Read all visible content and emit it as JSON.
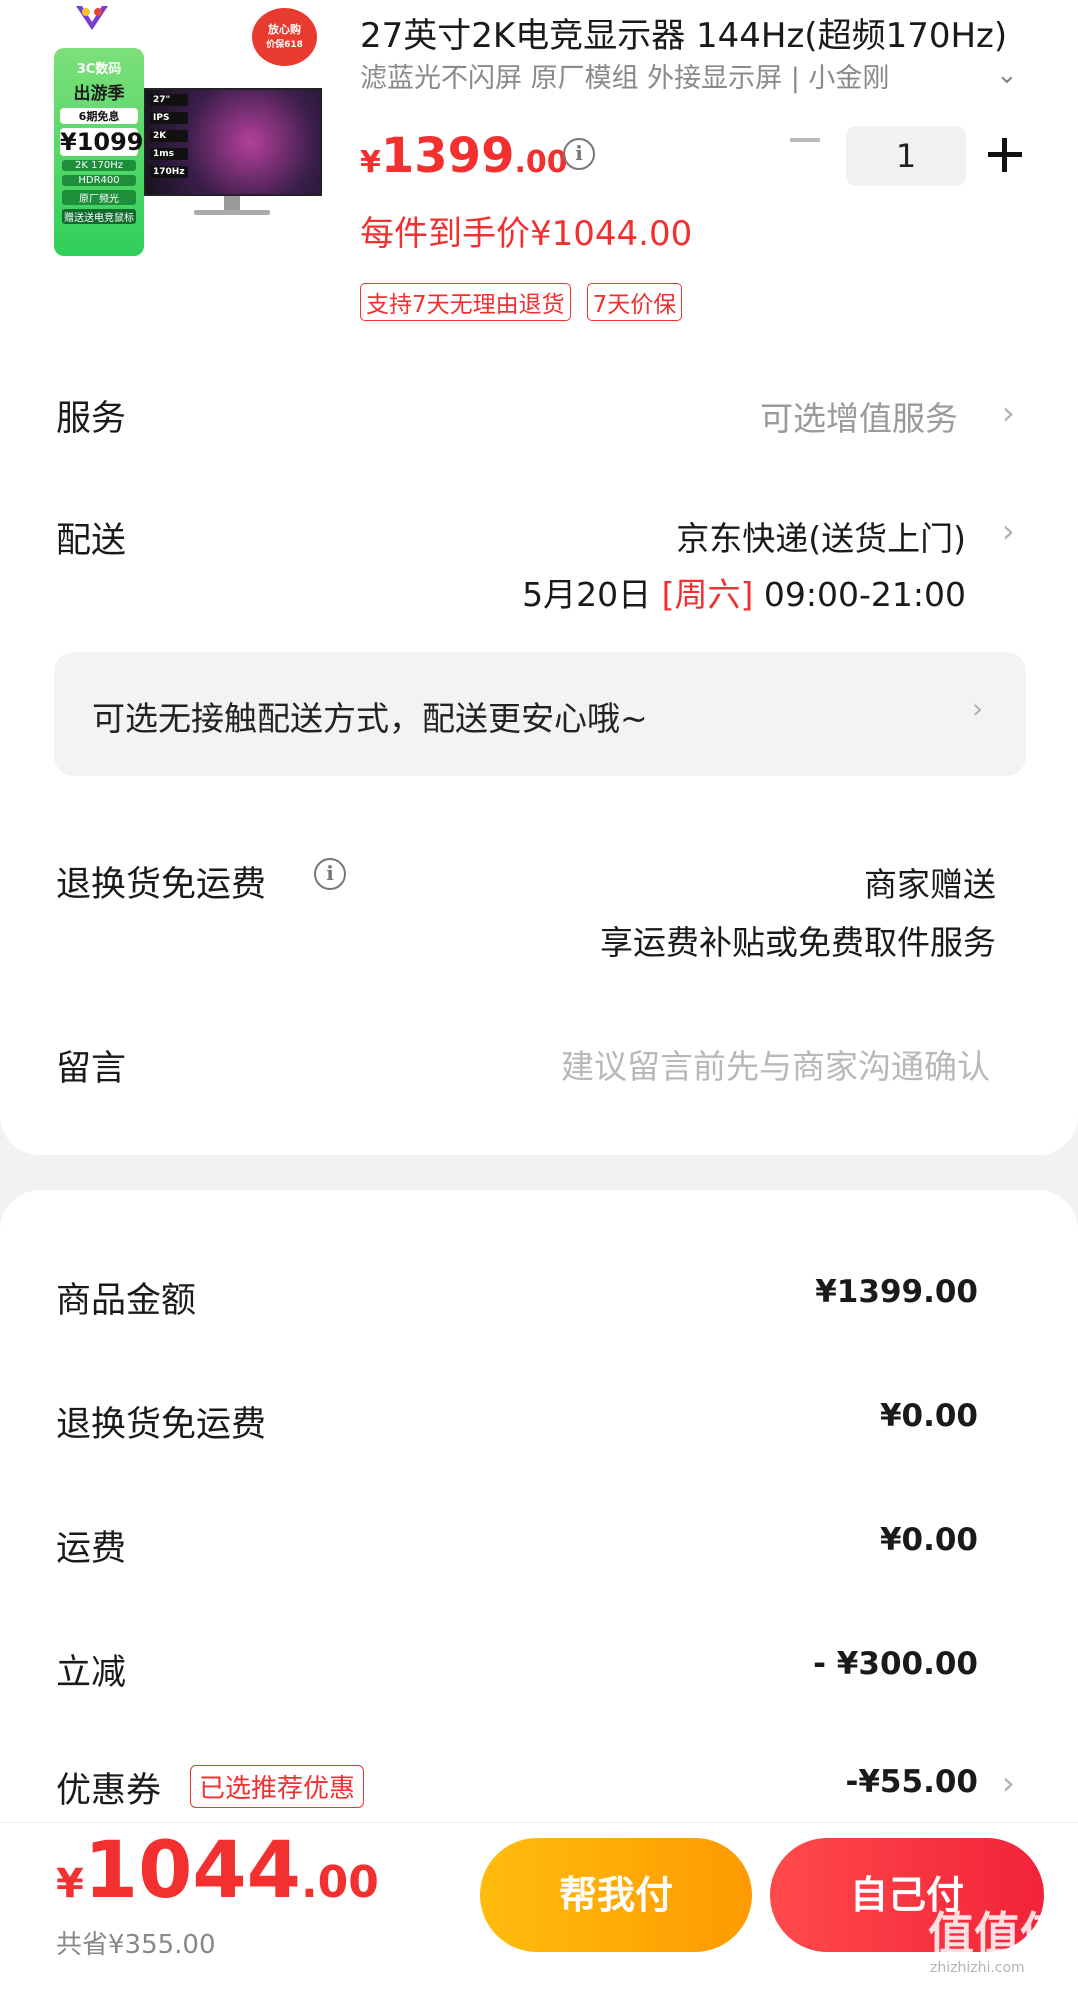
{
  "product": {
    "title": "27英寸2K电竞显示器 144Hz(超频170Hz)",
    "subtitle": "滤蓝光不闪屏 原厂模组 外接显示屏 | 小金刚",
    "price_yen": "¥",
    "price_int": "1399",
    "price_dec": ".00",
    "unit_price": "每件到手价¥1044.00",
    "tags": [
      "支持7天无理由退货",
      "7天价保"
    ],
    "quantity": "1",
    "image": {
      "brand": "ViewSonic",
      "badge_line1": "放心购",
      "badge_line2": "价保618",
      "promo_line1": "3C数码",
      "promo_line2": "出游季",
      "promo_line3": "6期免息",
      "promo_price": "¥1099",
      "promo_spec1": "2K 170Hz",
      "promo_spec2": "HDR400",
      "promo_spec3": "原厂频光",
      "promo_gift": "赠送送电竞鼠标",
      "specs": [
        "27\"",
        "IPS",
        "2K",
        "1ms",
        "170Hz"
      ]
    }
  },
  "service": {
    "label": "服务",
    "value": "可选增值服务"
  },
  "delivery": {
    "label": "配送",
    "method": "京东快递(送货上门)",
    "date": "5月20日",
    "weekday": "[周六]",
    "time": "09:00-21:00",
    "contactless": "可选无接触配送方式，配送更安心哦~"
  },
  "return_shipping": {
    "label": "退换货免运费",
    "value_line1": "商家赠送",
    "value_line2": "享运费补贴或免费取件服务"
  },
  "message": {
    "label": "留言",
    "placeholder": "建议留言前先与商家沟通确认"
  },
  "summary": {
    "goods_label": "商品金额",
    "goods_value": "¥1399.00",
    "return_label": "退换货免运费",
    "return_value": "¥0.00",
    "freight_label": "运费",
    "freight_value": "¥0.00",
    "discount_label": "立减",
    "discount_value": "- ¥300.00",
    "coupon_label": "优惠券",
    "coupon_tag": "已选推荐优惠",
    "coupon_value": "-¥55.00"
  },
  "bottom": {
    "total_yen": "¥",
    "total_int": "1044",
    "total_dec": ".00",
    "saved": "共省¥355.00",
    "help_pay": "帮我付",
    "self_pay": "自己付"
  },
  "watermark": {
    "text": "值值值",
    "site": "zhizhizhi.com"
  },
  "colors": {
    "accent_red": "#f23030",
    "help_btn": "#ffa800",
    "self_btn": "#f2223a"
  }
}
